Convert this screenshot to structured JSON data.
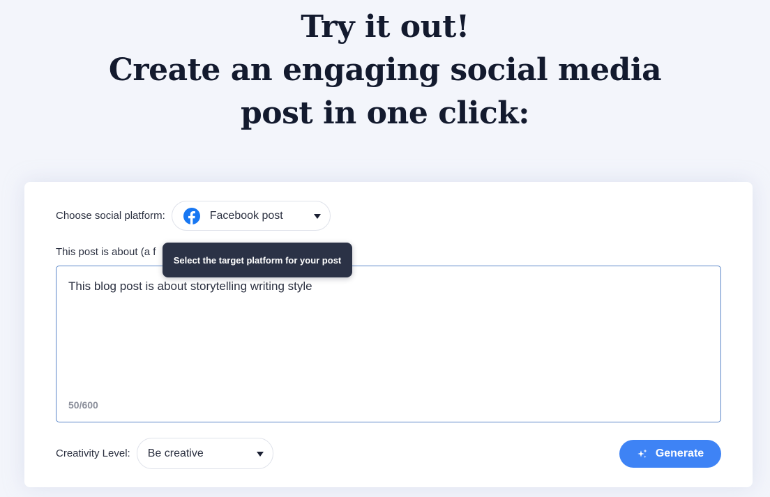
{
  "headline": {
    "line1": "Try it out!",
    "line2": "Create an engaging social media",
    "line3": "post in one click:"
  },
  "form": {
    "platform_label": "Choose social platform:",
    "platform_icon": "facebook-icon",
    "platform_value": "Facebook post",
    "about_label": "This post is about (a f",
    "textarea_value": "This blog post is about storytelling writing style",
    "char_counter": "50/600",
    "creativity_label": "Creativity Level:",
    "creativity_value": "Be creative",
    "generate_label": "Generate",
    "generate_icon": "sparkle-icon"
  },
  "tooltip": {
    "text": "Select the target platform for your post"
  },
  "colors": {
    "background": "#f3f5fb",
    "card": "#ffffff",
    "accent": "#3e83f5",
    "facebook": "#1877f2",
    "tooltip": "#2b3246",
    "textarea_border": "#5a86c8"
  }
}
